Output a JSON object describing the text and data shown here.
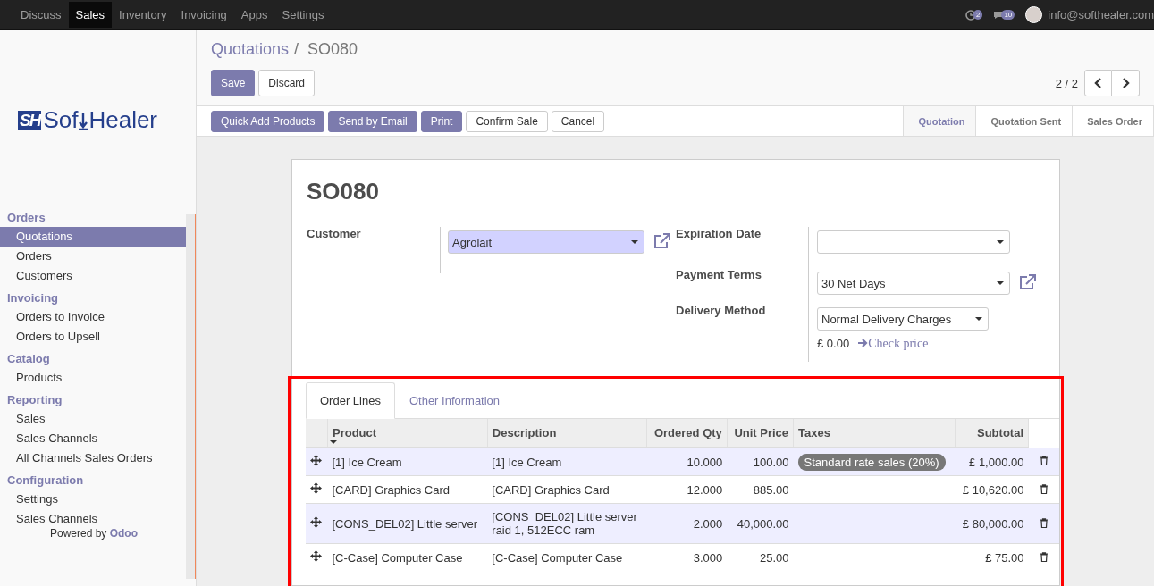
{
  "topbar": {
    "menu": [
      {
        "label": "Discuss",
        "selected": false
      },
      {
        "label": "Sales",
        "selected": true
      },
      {
        "label": "Inventory",
        "selected": false
      },
      {
        "label": "Invoicing",
        "selected": false
      },
      {
        "label": "Apps",
        "selected": false
      },
      {
        "label": "Settings",
        "selected": false
      }
    ],
    "activity_count": "2",
    "message_count": "10",
    "user": "info@softhealer.com"
  },
  "sidebar": {
    "logo": {
      "mark": "SH",
      "text_a": "Sof",
      "text_b": "Healer"
    },
    "sections": [
      {
        "title": "Orders",
        "items": [
          {
            "label": "Quotations",
            "selected": true
          },
          {
            "label": "Orders",
            "selected": false
          },
          {
            "label": "Customers",
            "selected": false
          }
        ]
      },
      {
        "title": "Invoicing",
        "items": [
          {
            "label": "Orders to Invoice",
            "selected": false
          },
          {
            "label": "Orders to Upsell",
            "selected": false
          }
        ]
      },
      {
        "title": "Catalog",
        "items": [
          {
            "label": "Products",
            "selected": false
          }
        ]
      },
      {
        "title": "Reporting",
        "items": [
          {
            "label": "Sales",
            "selected": false
          },
          {
            "label": "Sales Channels",
            "selected": false
          },
          {
            "label": "All Channels Sales Orders",
            "selected": false
          }
        ]
      },
      {
        "title": "Configuration",
        "items": [
          {
            "label": "Settings",
            "selected": false
          },
          {
            "label": "Sales Channels",
            "selected": false
          }
        ]
      }
    ],
    "footer": {
      "text": "Powered by",
      "brand": "Odoo"
    }
  },
  "breadcrumb": {
    "parent": "Quotations",
    "separator": "/",
    "current": "SO080"
  },
  "edit_buttons": [
    {
      "label": "Save",
      "kind": "primary"
    },
    {
      "label": "Discard",
      "kind": "default"
    }
  ],
  "pager": "2 / 2",
  "action_buttons": [
    {
      "label": "Quick Add Products",
      "kind": "primary"
    },
    {
      "label": "Send by Email",
      "kind": "primary"
    },
    {
      "label": "Print",
      "kind": "primary"
    },
    {
      "label": "Confirm Sale",
      "kind": "default"
    },
    {
      "label": "Cancel",
      "kind": "default"
    }
  ],
  "status_steps": [
    {
      "label": "Quotation",
      "selected": true
    },
    {
      "label": "Quotation Sent",
      "selected": false
    },
    {
      "label": "Sales Order",
      "selected": false
    }
  ],
  "form": {
    "title": "SO080",
    "customer": {
      "label": "Customer",
      "value": "Agrolait"
    },
    "right_fields": [
      {
        "label": "Expiration Date",
        "link": false
      },
      {
        "label": "Payment Terms",
        "value": "30 Net Days",
        "link": true
      },
      {
        "label": "Delivery Method",
        "value": "Normal Delivery Charges",
        "link": false
      }
    ],
    "delivery_price": "£ 0.00",
    "check_price": "Check price"
  },
  "tabs": [
    {
      "label": "Order Lines",
      "selected": true
    },
    {
      "label": "Other Information",
      "selected": false
    }
  ],
  "table": {
    "columns": [
      "Product",
      "Description",
      "Ordered Qty",
      "Unit Price",
      "Taxes",
      "Subtotal"
    ],
    "rows": [
      {
        "product": "[1] Ice Cream",
        "description": "[1] Ice Cream",
        "qty": "10.000",
        "price": "100.00",
        "tax": "Standard rate sales (20%)",
        "subtotal": "£ 1,000.00"
      },
      {
        "product": "[CARD] Graphics Card",
        "description": "[CARD] Graphics Card",
        "qty": "12.000",
        "price": "885.00",
        "subtotal": "£ 10,620.00"
      },
      {
        "product": "[CONS_DEL02] Little server",
        "description": "[CONS_DEL02] Little server raid 1, 512ECC ram",
        "qty": "2.000",
        "price": "40,000.00",
        "subtotal": "£ 80,000.00"
      },
      {
        "product": "[C-Case] Computer Case",
        "description": "[C-Case] Computer Case",
        "qty": "3.000",
        "price": "25.00",
        "subtotal": "£ 75.00"
      }
    ]
  }
}
